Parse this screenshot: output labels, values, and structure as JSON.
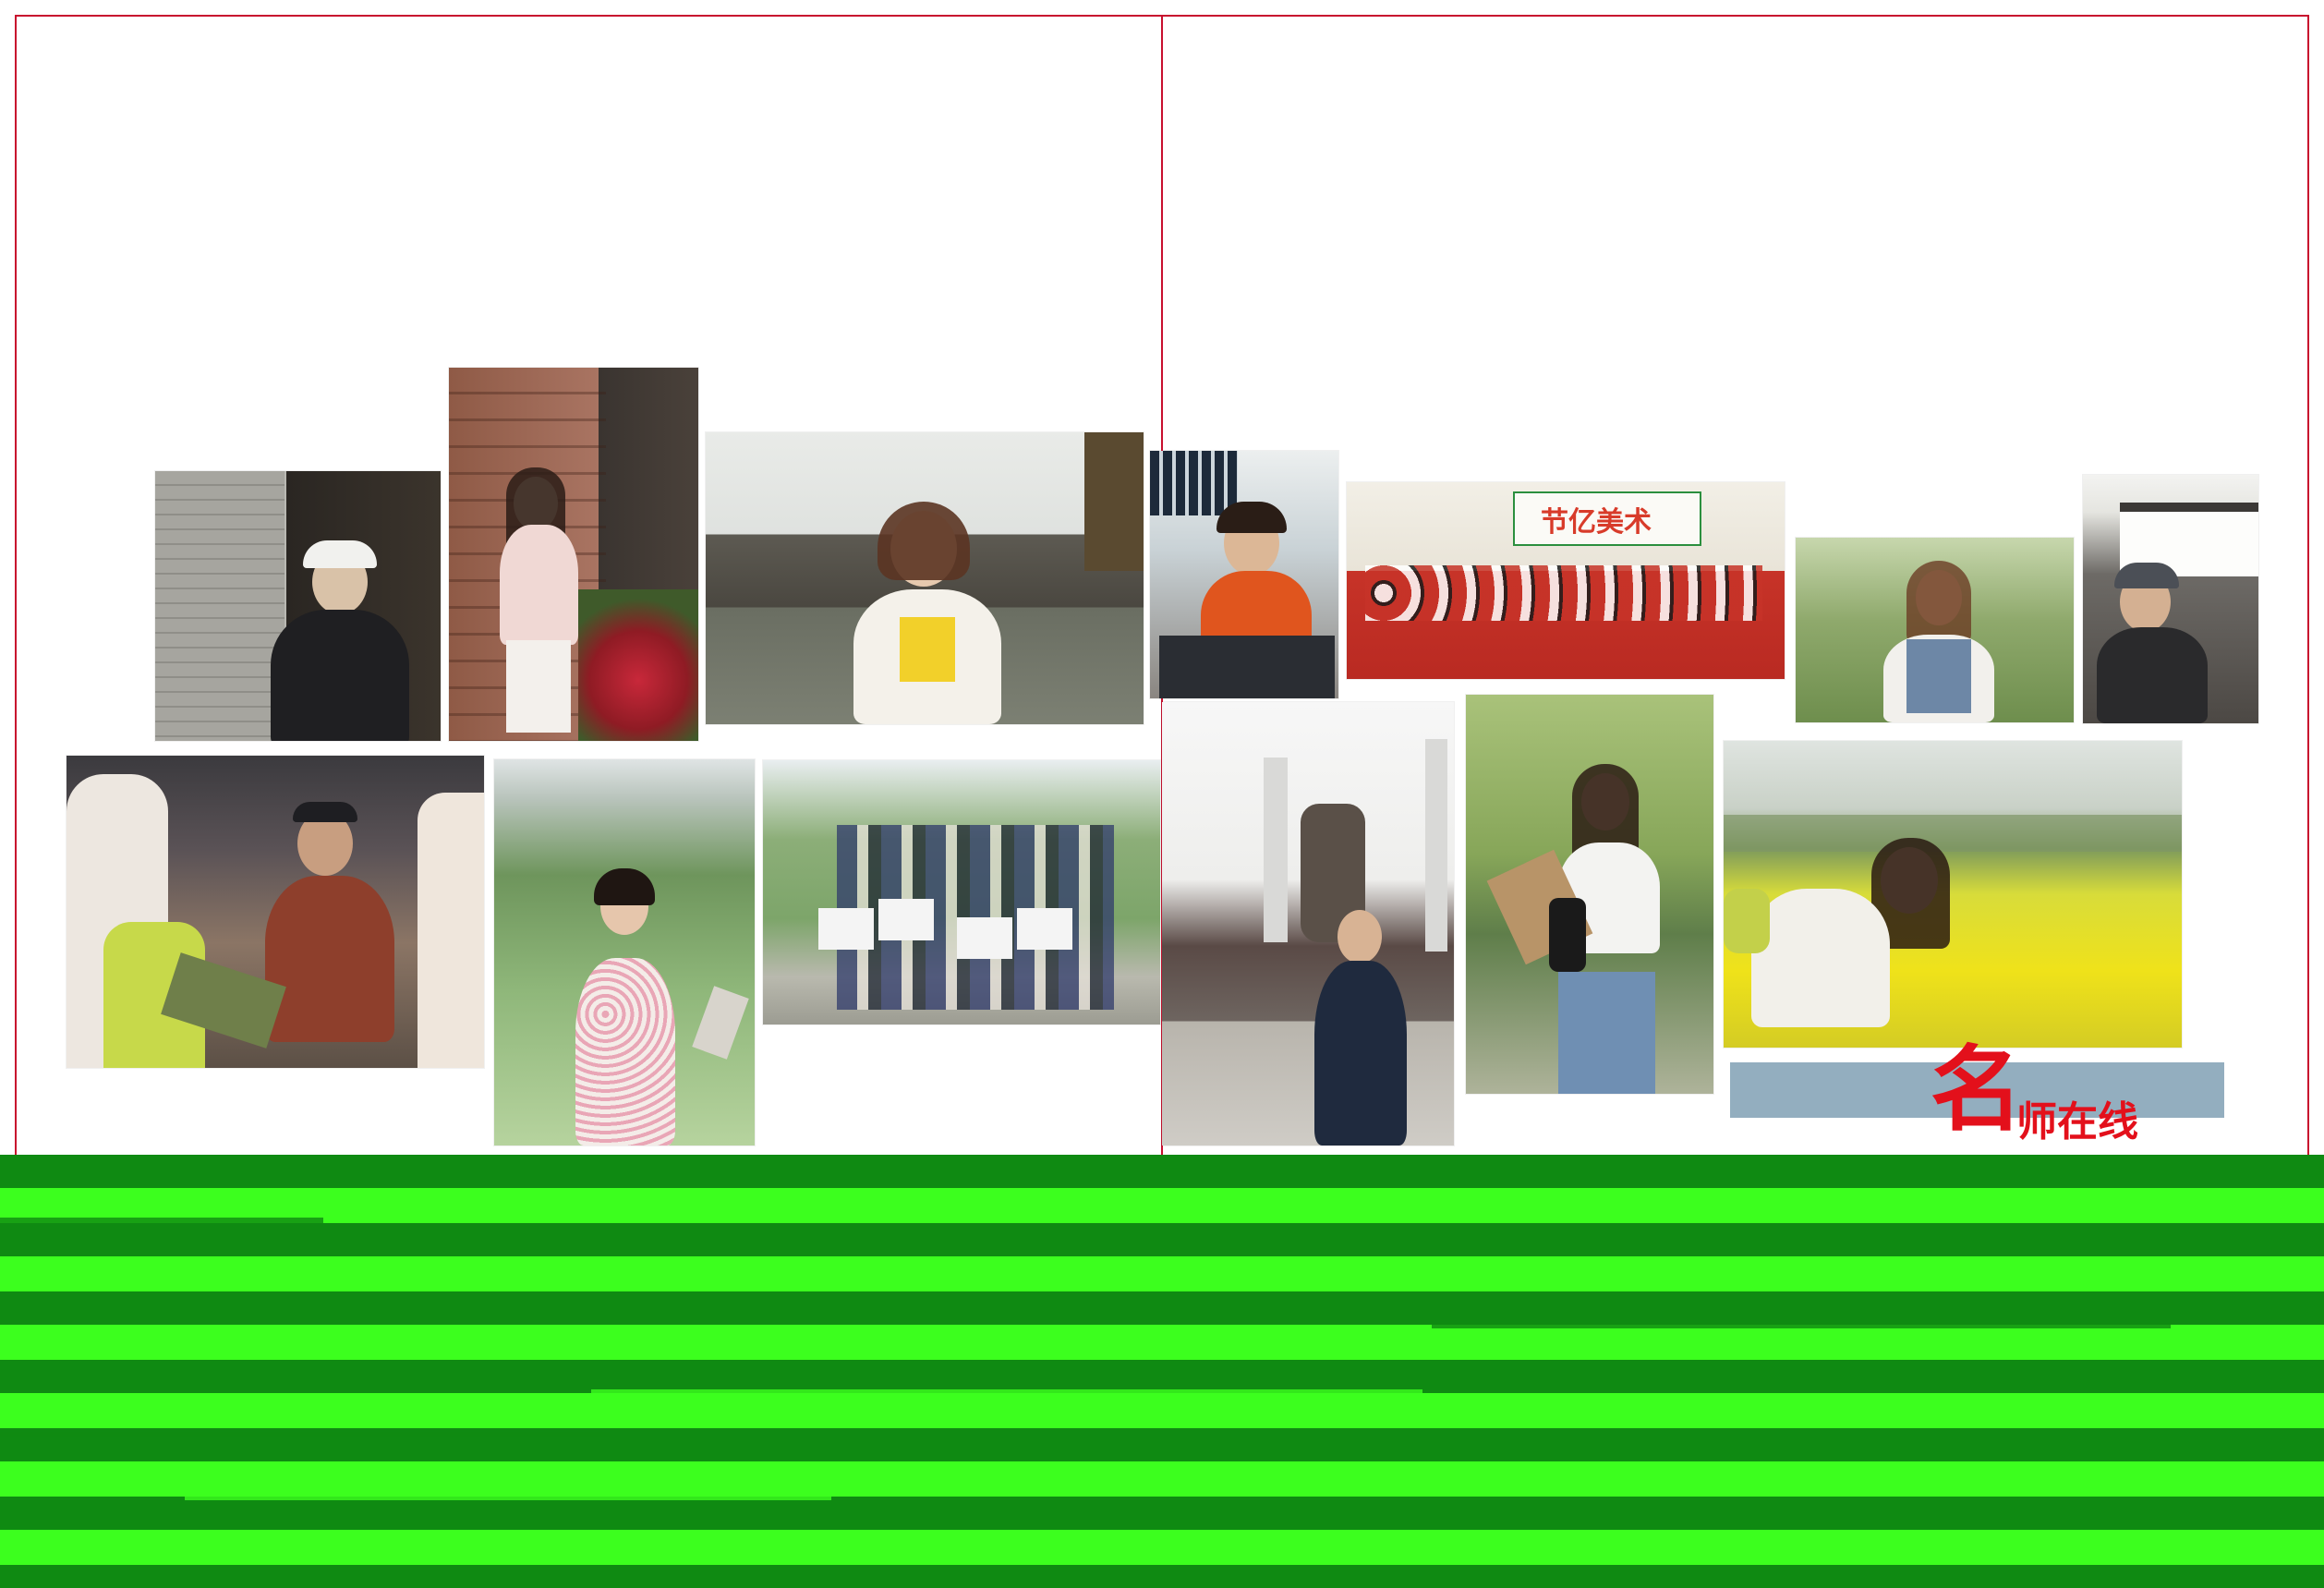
{
  "header": {
    "title_big": "名",
    "title_small": "师在线"
  },
  "photos": {
    "studio_sign_text": "节亿美术"
  },
  "colors": {
    "trim_line": "#c8102e",
    "title_red": "#e3101b",
    "title_bar": "#93aebf",
    "stripe_dark": "#0f8a12",
    "stripe_light": "#3cff1e"
  }
}
